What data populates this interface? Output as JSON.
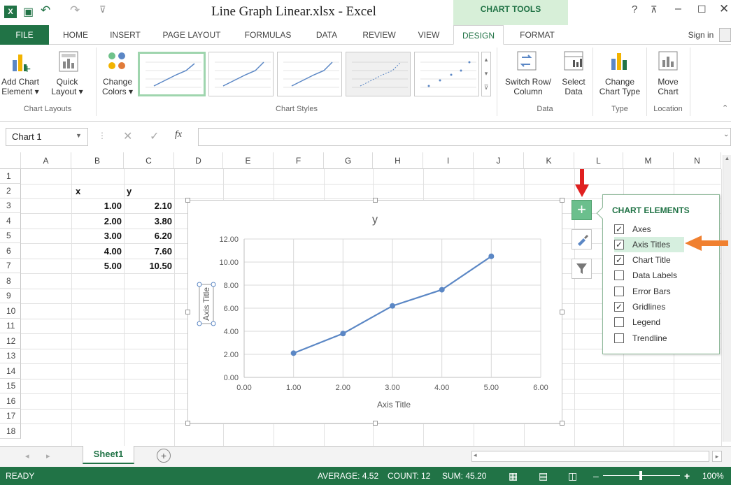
{
  "window": {
    "title": "Line Graph Linear.xlsx - Excel",
    "context_tab": "CHART TOOLS",
    "sign_in": "Sign in"
  },
  "tabs": [
    "FILE",
    "HOME",
    "INSERT",
    "PAGE LAYOUT",
    "FORMULAS",
    "DATA",
    "REVIEW",
    "VIEW",
    "DESIGN",
    "FORMAT"
  ],
  "ribbon": {
    "add_chart_element": [
      "Add Chart",
      "Element ▾"
    ],
    "quick_layout": [
      "Quick",
      "Layout ▾"
    ],
    "change_colors": [
      "Change",
      "Colors ▾"
    ],
    "switch_row_col": [
      "Switch Row/",
      "Column"
    ],
    "select_data": [
      "Select",
      "Data"
    ],
    "change_chart_type": [
      "Change",
      "Chart Type"
    ],
    "move_chart": [
      "Move",
      "Chart"
    ],
    "groups": {
      "layouts": "Chart Layouts",
      "styles": "Chart Styles",
      "data": "Data",
      "type": "Type",
      "location": "Location"
    }
  },
  "formula_bar": {
    "name_box": "Chart 1",
    "fx": "fx",
    "value": ""
  },
  "columns": [
    "A",
    "B",
    "C",
    "D",
    "E",
    "F",
    "G",
    "H",
    "I",
    "J",
    "K",
    "L",
    "M",
    "N"
  ],
  "rows": [
    "1",
    "2",
    "3",
    "4",
    "5",
    "6",
    "7",
    "8",
    "9",
    "10",
    "11",
    "12",
    "13",
    "14",
    "15",
    "16",
    "17",
    "18"
  ],
  "cells": {
    "headers": {
      "x": "x",
      "y": "y"
    },
    "x_values": [
      "1.00",
      "2.00",
      "3.00",
      "4.00",
      "5.00"
    ],
    "y_values": [
      "2.10",
      "3.80",
      "6.20",
      "7.60",
      "10.50"
    ]
  },
  "chart_data": {
    "type": "scatter",
    "title": "y",
    "xlabel": "Axis Title",
    "ylabel": "Axis Title",
    "xlim": [
      0,
      6
    ],
    "ylim": [
      0,
      12
    ],
    "x_ticks": [
      "0.00",
      "1.00",
      "2.00",
      "3.00",
      "4.00",
      "5.00",
      "6.00"
    ],
    "y_ticks": [
      "0.00",
      "2.00",
      "4.00",
      "6.00",
      "8.00",
      "10.00",
      "12.00"
    ],
    "grid": true,
    "series": [
      {
        "x": [
          1,
          2,
          3,
          4,
          5
        ],
        "y": [
          2.1,
          3.8,
          6.2,
          7.6,
          10.5
        ],
        "color": "#5b87c5"
      }
    ]
  },
  "chart_elements": {
    "title": "CHART ELEMENTS",
    "items": [
      {
        "label": "Axes",
        "checked": true
      },
      {
        "label": "Axis Titles",
        "checked": true
      },
      {
        "label": "Chart Title",
        "checked": true
      },
      {
        "label": "Data Labels",
        "checked": false
      },
      {
        "label": "Error Bars",
        "checked": false
      },
      {
        "label": "Gridlines",
        "checked": true
      },
      {
        "label": "Legend",
        "checked": false
      },
      {
        "label": "Trendline",
        "checked": false
      }
    ]
  },
  "sheet": {
    "tab": "Sheet1"
  },
  "status": {
    "mode": "READY",
    "average": "AVERAGE: 4.52",
    "count": "COUNT: 12",
    "sum": "SUM: 45.20",
    "zoom": "100%"
  },
  "colors": {
    "excel_green": "#217346",
    "arrow_red": "#e02020",
    "arrow_orange": "#f08030"
  }
}
